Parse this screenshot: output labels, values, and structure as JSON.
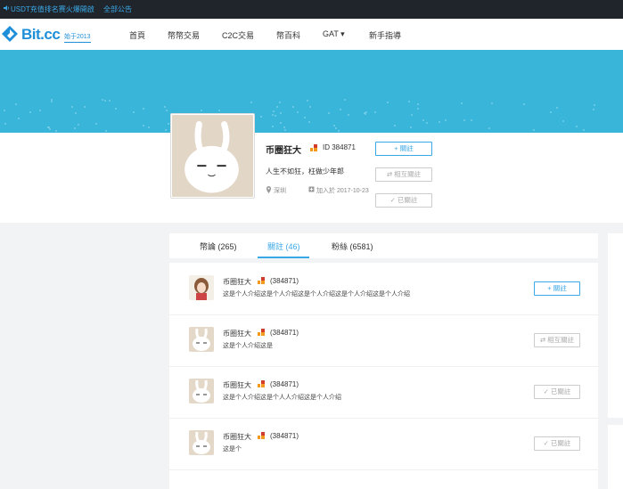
{
  "topbar": {
    "announcement": "USDT充值排名赛火爆開啟",
    "all_notices": "全部公告"
  },
  "logo": {
    "brand": "Bit.cc",
    "since": "始于2013"
  },
  "nav": [
    {
      "label": "首頁"
    },
    {
      "label": "幣幣交易"
    },
    {
      "label": "C2C交易"
    },
    {
      "label": "幣百科"
    },
    {
      "label": "GAT ▾"
    },
    {
      "label": "新手指導"
    }
  ],
  "profile": {
    "name": "币圈狂大",
    "id_label": "ID 384871",
    "bio": "人生不如狂，枉做少年郎",
    "location": "深圳",
    "joined": "加入於 2017-10-23",
    "btn_follow": "+ 關註",
    "btn_mutual": "⇄ 相互關註",
    "btn_followed": "✓ 已關註"
  },
  "tabs": [
    {
      "label": "幣論 (265)"
    },
    {
      "label": "關註 (46)"
    },
    {
      "label": "粉絲 (6581)"
    }
  ],
  "active_tab": 1,
  "rows": [
    {
      "name": "币圈狂大",
      "uid": "(384871)",
      "bio": "这是个人介绍这是个人介绍这是个人介绍这是个人介绍这是个人介绍",
      "button": "+ 關註",
      "state": "follow"
    },
    {
      "name": "币圈狂大",
      "uid": "(384871)",
      "bio": "这是个人介绍这是",
      "button": "⇄ 相互關註",
      "state": "mutual"
    },
    {
      "name": "币圈狂大",
      "uid": "(384871)",
      "bio": "这是个人介绍这是个人人介绍这是个人介绍",
      "button": "✓ 已關註",
      "state": "followed"
    },
    {
      "name": "币圈狂大",
      "uid": "(384871)",
      "bio": "这是个",
      "button": "✓ 已關註",
      "state": "followed"
    }
  ],
  "colors": {
    "accent": "#3aa7e6",
    "banner": "#39b5da",
    "topbar": "#20252b",
    "badge_orange": "#f39a1e",
    "badge_red": "#d23c2a"
  }
}
